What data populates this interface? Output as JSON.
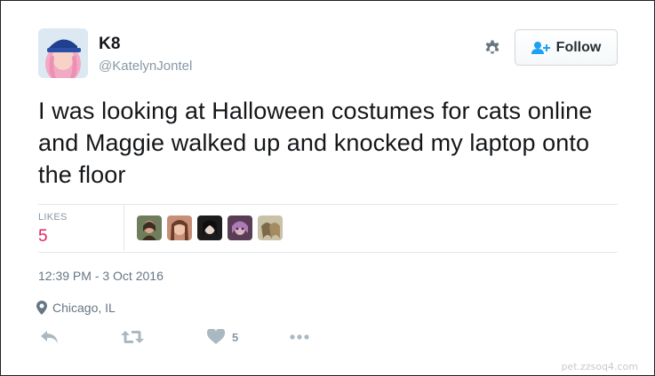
{
  "user": {
    "display_name": "K8",
    "handle": "@KatelynJontel",
    "avatar_icon": "user-avatar-photo"
  },
  "header": {
    "settings_icon": "gear-icon",
    "follow_label": "Follow",
    "follow_icon": "add-user-icon"
  },
  "tweet": {
    "text": "I was looking at Halloween costumes for cats online and Maggie walked up and knocked my laptop onto the floor"
  },
  "stats": {
    "likes_label": "LIKES",
    "likes_count": "5",
    "liker_avatars": [
      "liker-avatar-1",
      "liker-avatar-2",
      "liker-avatar-3",
      "liker-avatar-4",
      "liker-avatar-5"
    ]
  },
  "meta": {
    "timestamp": "12:39 PM - 3 Oct 2016",
    "location": "Chicago, IL",
    "location_icon": "map-pin-icon"
  },
  "actions": {
    "reply_icon": "reply-icon",
    "retweet_icon": "retweet-icon",
    "like_icon": "heart-icon",
    "like_count": "5",
    "more_icon": "more-icon"
  },
  "watermark": "pet.zzsoq4.com",
  "colors": {
    "like_count": "#e0245e",
    "secondary_text": "#8899a6",
    "follow_icon": "#1da1f2"
  }
}
